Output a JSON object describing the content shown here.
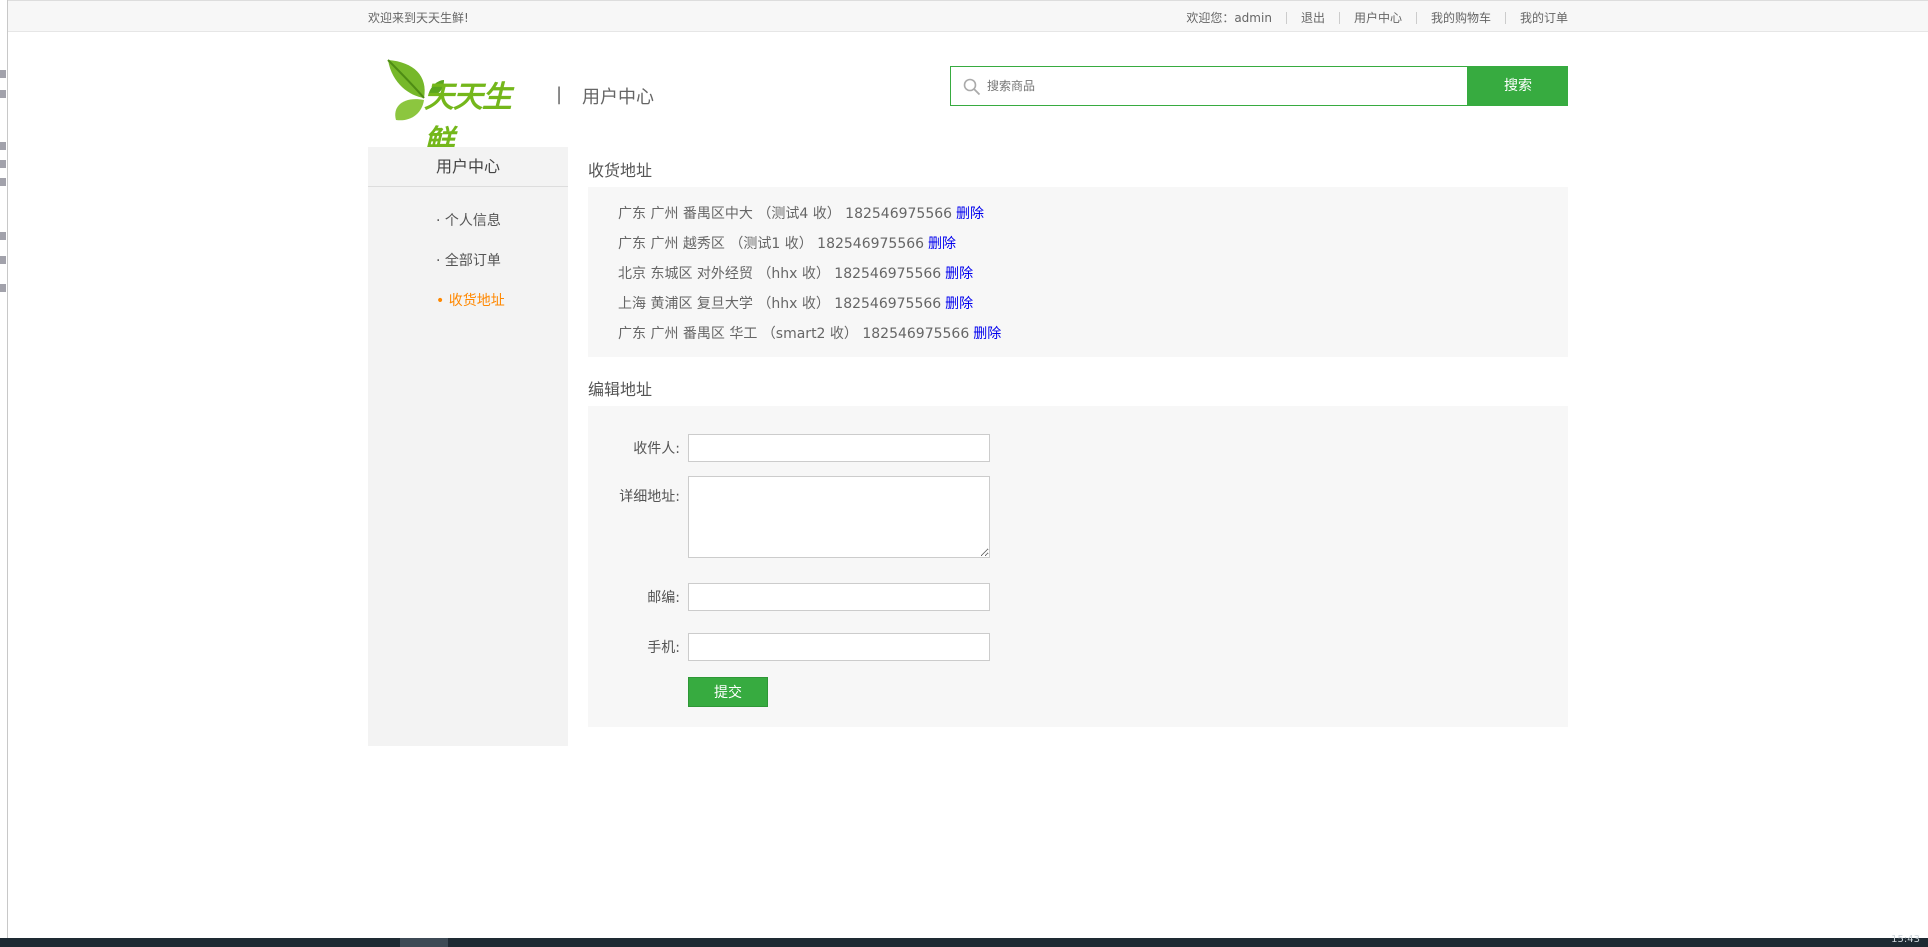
{
  "topbar": {
    "welcome": "欢迎来到天天生鲜!",
    "greeting": "欢迎您：admin",
    "links": [
      "退出",
      "用户中心",
      "我的购物车",
      "我的订单"
    ]
  },
  "logo": {
    "text": "天天生鲜",
    "divider": "|",
    "subtitle": "用户中心"
  },
  "search": {
    "placeholder": "搜索商品",
    "button_label": "搜索"
  },
  "sidebar": {
    "title": "用户中心",
    "items": [
      {
        "label": "· 个人信息",
        "active": false
      },
      {
        "label": "· 全部订单",
        "active": false
      },
      {
        "label": "• 收货地址",
        "active": true
      }
    ]
  },
  "addresses": {
    "title": "收货地址",
    "delete_label": "删除",
    "rows": [
      "广东 广州 番禺区中大 （测试4 收） 182546975566",
      "广东 广州 越秀区 （测试1 收） 182546975566",
      "北京 东城区 对外经贸 （hhx 收） 182546975566",
      "上海 黄浦区 复旦大学 （hhx 收） 182546975566",
      "广东 广州 番禺区 华工 （smart2 收） 182546975566"
    ]
  },
  "edit_form": {
    "title": "编辑地址",
    "receiver_label": "收件人:",
    "address_label": "详细地址:",
    "zip_label": "邮编:",
    "phone_label": "手机:",
    "submit_label": "提交",
    "receiver_value": "",
    "address_value": "",
    "zip_value": "",
    "phone_value": ""
  },
  "colors": {
    "brand_green": "#37ab40",
    "active_orange": "#ff8800",
    "link_blue": "#0000ee",
    "panel_bg": "#f7f7f7"
  },
  "taskbar": {
    "clock": "15:43"
  }
}
